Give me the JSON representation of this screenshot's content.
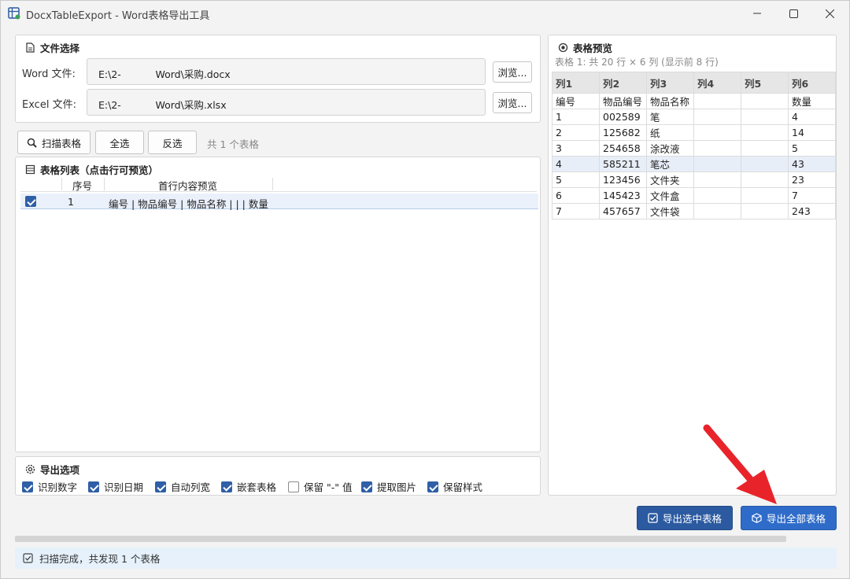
{
  "window": {
    "title": "DocxTableExport - Word表格导出工具"
  },
  "file_section": {
    "title": "文件选择",
    "word_label": "Word 文件:",
    "word_path": "E:\\2-           Word\\采购.docx",
    "excel_label": "Excel 文件:",
    "excel_path": "E:\\2-           Word\\采购.xlsx",
    "browse_label": "浏览..."
  },
  "toolbar": {
    "scan_label": "扫描表格",
    "select_all_label": "全选",
    "invert_label": "反选",
    "count_text": "共 1 个表格"
  },
  "table_list": {
    "title": "表格列表（点击行可预览）",
    "columns": [
      "序号",
      "首行内容预览"
    ],
    "rows": [
      {
        "checked": true,
        "index": "1",
        "preview": "编号 | 物品编号 | 物品名称 | | | 数量"
      }
    ]
  },
  "options": {
    "title": "导出选项",
    "items": [
      {
        "label": "识别数字",
        "checked": true
      },
      {
        "label": "识别日期",
        "checked": true
      },
      {
        "label": "自动列宽",
        "checked": true
      },
      {
        "label": "嵌套表格",
        "checked": true
      },
      {
        "label": "保留 \"-\" 值",
        "checked": false
      },
      {
        "label": "提取图片",
        "checked": true
      },
      {
        "label": "保留样式",
        "checked": true
      }
    ]
  },
  "preview": {
    "title": "表格预览",
    "subtitle": "表格 1: 共 20 行 × 6 列 (显示前 8 行)",
    "headers": [
      "列1",
      "列2",
      "列3",
      "列4",
      "列5",
      "列6"
    ],
    "rows": [
      [
        "编号",
        "物品编号",
        "物品名称",
        "",
        "",
        "数量"
      ],
      [
        "1",
        "002589",
        "笔",
        "",
        "",
        "4"
      ],
      [
        "2",
        "125682",
        "纸",
        "",
        "",
        "14"
      ],
      [
        "3",
        "254658",
        "涂改液",
        "",
        "",
        "5"
      ],
      [
        "4",
        "585211",
        "笔芯",
        "",
        "",
        "43"
      ],
      [
        "5",
        "123456",
        "文件夹",
        "",
        "",
        "23"
      ],
      [
        "6",
        "145423",
        "文件盒",
        "",
        "",
        "7"
      ],
      [
        "7",
        "457657",
        "文件袋",
        "",
        "",
        "243"
      ]
    ],
    "selected_row": 4
  },
  "actions": {
    "export_selected_label": "导出选中表格",
    "export_all_label": "导出全部表格"
  },
  "status": {
    "text": "扫描完成，共发现 1 个表格"
  },
  "colors": {
    "primary": "#2b5aa0",
    "accent_arrow": "#e8242a",
    "status_bg": "#e6f1fb"
  }
}
